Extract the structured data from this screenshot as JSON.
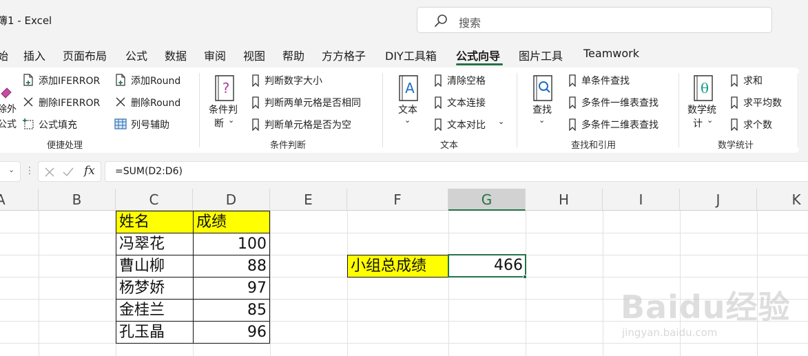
{
  "title_bar": {
    "doc_title": "簿1  -  Excel",
    "search_placeholder": "搜索"
  },
  "menu": {
    "tabs": [
      {
        "label": "始"
      },
      {
        "label": "插入"
      },
      {
        "label": "页面布局"
      },
      {
        "label": "公式"
      },
      {
        "label": "数据"
      },
      {
        "label": "审阅"
      },
      {
        "label": "视图"
      },
      {
        "label": "帮助"
      },
      {
        "label": "方方格子"
      },
      {
        "label": "DIY工具箱"
      },
      {
        "label": "公式向导"
      },
      {
        "label": "图片工具"
      },
      {
        "label": "Teamwork"
      }
    ],
    "active_tab": "公式向导"
  },
  "ribbon": {
    "group_quick": {
      "label": "便捷处理",
      "big_button_line1": "除外",
      "big_button_line2": "公式",
      "add_iferror": "添加IFERROR",
      "del_iferror": "删除IFERROR",
      "formula_fill": "公式填充",
      "add_round": "添加Round",
      "del_round": "删除Round",
      "col_helper": "列号辅助"
    },
    "group_cond": {
      "label": "条件判断",
      "big_button_line1": "条件判",
      "big_button_line2": "断",
      "item1": "判断数字大小",
      "item2": "判断两单元格是否相同",
      "item3": "判断单元格是否为空"
    },
    "group_text": {
      "label": "文本",
      "big_button": "文本",
      "item1": "清除空格",
      "item2": "文本连接",
      "item3": "文本对比"
    },
    "group_lookup": {
      "label": "查找和引用",
      "big_button": "查找",
      "item1": "单条件查找",
      "item2": "多条件一维表查找",
      "item3": "多条件二维表查找"
    },
    "group_stats": {
      "label": "数学统计",
      "big_button_line1": "数学统",
      "big_button_line2": "计",
      "item1": "求和",
      "item2": "求平均数",
      "item3": "求个数"
    }
  },
  "formula_bar": {
    "fx": "fx",
    "formula": "=SUM(D2:D6)"
  },
  "sheet": {
    "columns": [
      "A",
      "B",
      "C",
      "D",
      "E",
      "F",
      "G",
      "H",
      "I",
      "J",
      "K"
    ],
    "selected_column": "G",
    "table_header": {
      "name": "姓名",
      "score": "成绩"
    },
    "rows": [
      {
        "name": "冯翠花",
        "score": "100"
      },
      {
        "name": "曹山柳",
        "score": "88"
      },
      {
        "name": "杨梦娇",
        "score": "97"
      },
      {
        "name": "金桂兰",
        "score": "85"
      },
      {
        "name": "孔玉晶",
        "score": "96"
      }
    ],
    "total_label": "小组总成绩",
    "total_value": "466"
  },
  "watermark": {
    "brand": "Baidu经验",
    "url": "jingyan.baidu.com"
  },
  "colors": {
    "accent": "#217346",
    "highlight": "#ffff00"
  }
}
